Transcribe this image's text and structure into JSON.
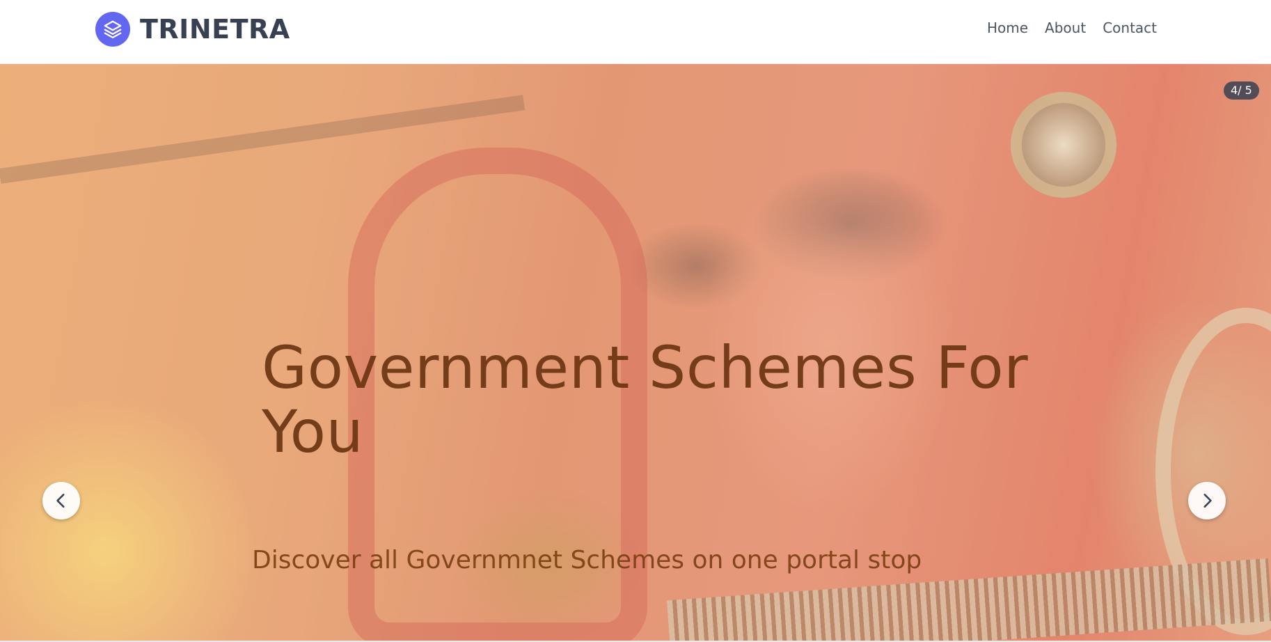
{
  "header": {
    "brand_name": "TRINETRA",
    "logo_icon": "layers-icon",
    "logo_color": "#6366f1",
    "nav": [
      {
        "label": "Home"
      },
      {
        "label": "About"
      },
      {
        "label": "Contact"
      }
    ]
  },
  "hero": {
    "slide_counter": "4/ 5",
    "current_slide": 4,
    "total_slides": 5,
    "title": "Government Schemes For You",
    "subtitle": "Discover all Governmnet Schemes on one portal stop",
    "prev_icon": "chevron-left-icon",
    "next_icon": "chevron-right-icon"
  }
}
